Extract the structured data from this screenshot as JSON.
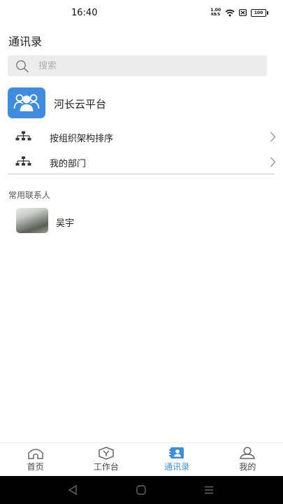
{
  "status_bar": {
    "time": "16:40",
    "net_speed_value": "1.00",
    "net_speed_unit": "KB/S",
    "battery": "100"
  },
  "header": {
    "title": "通讯录"
  },
  "search": {
    "placeholder": "搜索"
  },
  "organization": {
    "name": "河长云平台",
    "logo_icon": "group-icon",
    "logo_color": "#3d8ce2"
  },
  "menu": {
    "items": [
      {
        "label": "按组织架构排序",
        "icon": "org-tree-icon"
      },
      {
        "label": "我的部门",
        "icon": "org-tree-icon"
      }
    ]
  },
  "contacts": {
    "section_title": "常用联系人",
    "items": [
      {
        "name": "吴宇"
      }
    ]
  },
  "tab_bar": {
    "accent_color": "#3b8fe0",
    "tabs": [
      {
        "label": "首页",
        "icon": "home-icon",
        "active": false
      },
      {
        "label": "工作台",
        "icon": "workbench-icon",
        "active": false
      },
      {
        "label": "通讯录",
        "icon": "contacts-icon",
        "active": true
      },
      {
        "label": "我的",
        "icon": "user-icon",
        "active": false
      }
    ]
  },
  "system_nav": {
    "buttons": [
      "back-icon",
      "home-circle-icon",
      "menu-icon"
    ]
  }
}
